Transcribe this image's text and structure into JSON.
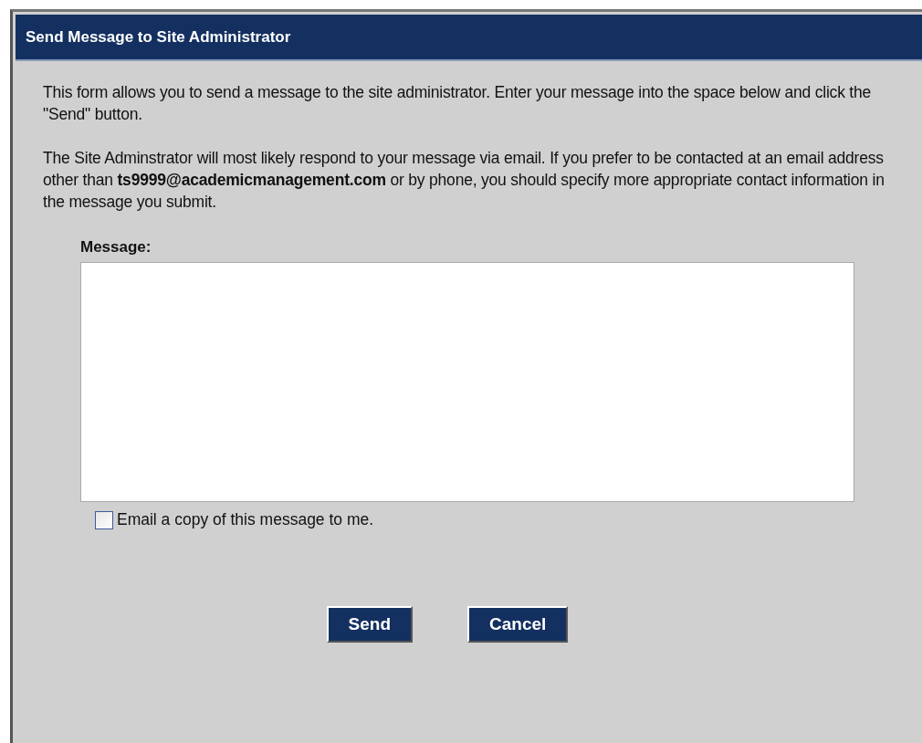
{
  "dialog": {
    "title": "Send Message to Site Administrator",
    "paragraphs": [
      "This form allows you to send a message to the site administrator. Enter your message into the space below and click the \"Send\" button.",
      "The Site Adminstrator will most likely respond to your message via email. If you prefer to be contacted at an email address other than **ts9999@academicmanagement.com** or by phone, you should specify more appropriate contact information in the message you submit."
    ],
    "message_label": "Message:",
    "copy_option": {
      "label": "Email a copy of this message to me.",
      "checked": false
    },
    "buttons": [
      "Send",
      "Cancel"
    ]
  }
}
